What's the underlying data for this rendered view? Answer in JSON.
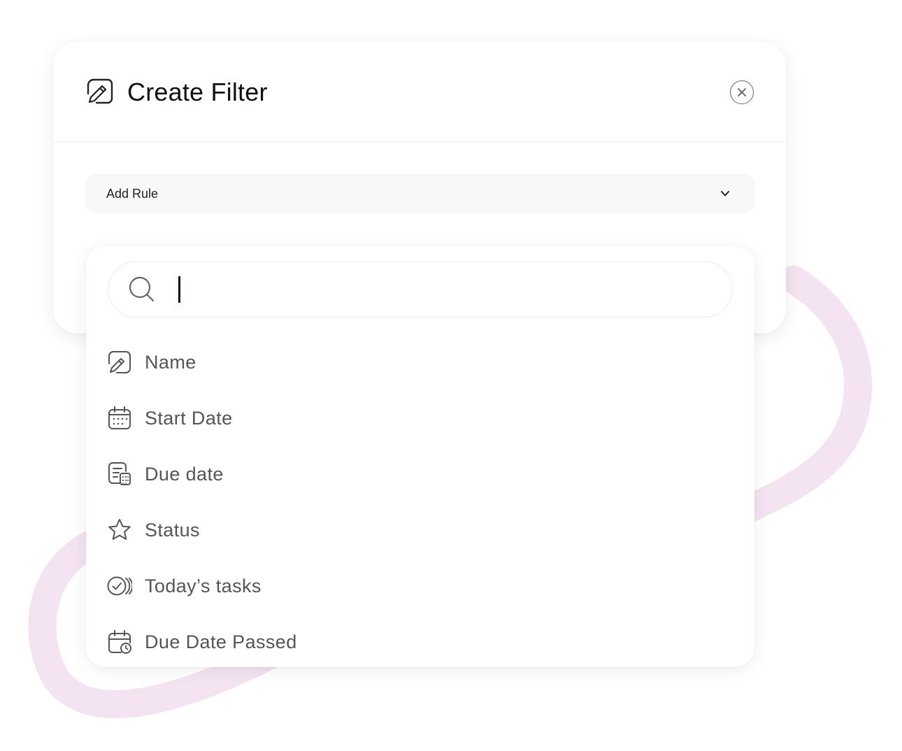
{
  "modal": {
    "title": "Create Filter",
    "header_icon": "edit-icon",
    "close_icon": "close-icon"
  },
  "rule_select": {
    "label": "Add Rule",
    "icon": "chevron-down-icon"
  },
  "search": {
    "value": "",
    "icon": "search-icon"
  },
  "options": [
    {
      "label": "Name",
      "icon": "edit-icon"
    },
    {
      "label": "Start Date",
      "icon": "calendar-icon"
    },
    {
      "label": "Due date",
      "icon": "calendar-list-icon"
    },
    {
      "label": "Status",
      "icon": "star-icon"
    },
    {
      "label": "Today’s tasks",
      "icon": "check-circle-icon"
    },
    {
      "label": "Due Date Passed",
      "icon": "calendar-clock-icon"
    }
  ],
  "colors": {
    "swoosh": "#f4e3f1",
    "text_primary": "#111111",
    "text_option": "#555555",
    "field_bg": "#f8f8f8"
  }
}
